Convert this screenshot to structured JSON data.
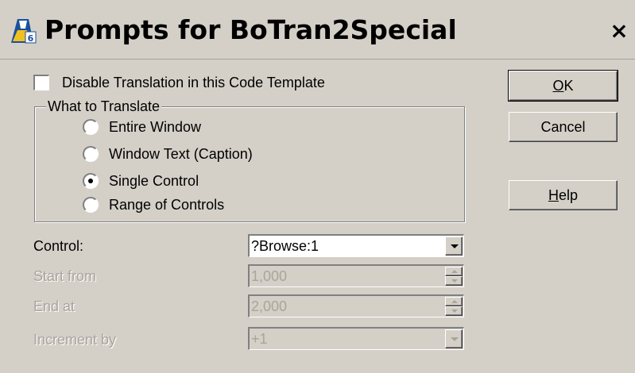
{
  "window": {
    "title": "Prompts for BoTran2Special",
    "icon": "clarion-template-icon",
    "close_label": "×"
  },
  "disable_checkbox": {
    "label": "Disable Translation in this Code Template",
    "checked": false
  },
  "translate_group": {
    "legend": "What to Translate",
    "options": [
      {
        "label": "Entire Window",
        "selected": false
      },
      {
        "label": "Window Text (Caption)",
        "selected": false
      },
      {
        "label": "Single Control",
        "selected": true
      },
      {
        "label": "Range of Controls",
        "selected": false
      }
    ]
  },
  "fields": {
    "control": {
      "label": "Control:",
      "value": "?Browse:1",
      "enabled": true
    },
    "start_from": {
      "label": "Start from",
      "value": "1,000",
      "enabled": false
    },
    "end_at": {
      "label": "End at",
      "value": "2,000",
      "enabled": false
    },
    "increment_by": {
      "label": "Increment by",
      "value": "+1",
      "enabled": false
    }
  },
  "buttons": {
    "ok": {
      "label": "OK",
      "mnemonic": "O"
    },
    "cancel": {
      "label": "Cancel"
    },
    "help": {
      "label": "Help",
      "mnemonic": "H"
    }
  },
  "colors": {
    "face": "#d4d0c8",
    "disabled_text": "#a9a59d"
  }
}
